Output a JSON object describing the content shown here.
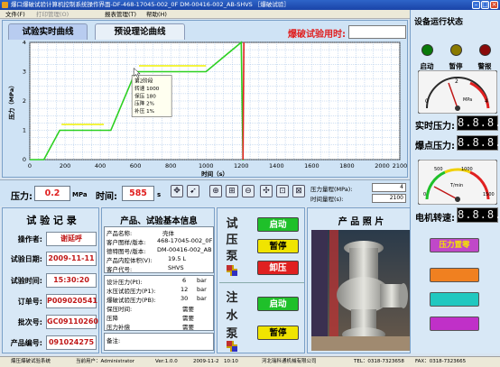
{
  "window": {
    "title": "爆口爆破试验计算机控制系统操作界面-DF-468-17045-002_0F DM-00416-002_AB-SHVS ［爆破试验］"
  },
  "menu": [
    "文件(F)",
    "打印管理(O)",
    "报表管理(T)",
    "帮助(H)"
  ],
  "chart": {
    "tabs": [
      "试验实时曲线",
      "预设理论曲线"
    ],
    "burst_time_label": "爆破试验用时:",
    "tooltip": [
      "第2阶段",
      "转速  1000",
      "保压  180",
      "压降  2%",
      "补压  1%"
    ]
  },
  "chart_data": {
    "type": "line",
    "xlabel": "时间（s）",
    "ylabel": "压力（MPa）",
    "xlim": [
      0,
      2100
    ],
    "ylim": [
      0,
      4
    ],
    "xticks": [
      0,
      200,
      400,
      600,
      800,
      1000,
      1200,
      1400,
      1600,
      1800,
      2000,
      2100
    ],
    "yticks": [
      0,
      1,
      2,
      3,
      4
    ],
    "grid": true,
    "series": [
      {
        "x": [
          0,
          80,
          170,
          190,
          270,
          420,
          460,
          600,
          660,
          980,
          1000,
          1200,
          1210,
          1215
        ],
        "y": [
          0,
          0,
          1.0,
          1.0,
          1.0,
          1.0,
          1.0,
          3.0,
          3.0,
          3.0,
          3.0,
          4.5,
          0,
          0
        ],
        "color": "#2cd020"
      },
      {
        "x": [
          1210,
          1215
        ],
        "y": [
          0,
          4.5
        ],
        "color": "#e02020"
      }
    ],
    "hold_lines": [
      {
        "x": [
          180,
          420
        ],
        "y": 1.2,
        "color": "#f0f000"
      },
      {
        "x": [
          620,
          1000
        ],
        "y": 3.2,
        "color": "#f0f000"
      }
    ],
    "tooltip_point": {
      "x": 600,
      "y": 3.0
    }
  },
  "controls": {
    "pressure_label": "压力:",
    "pressure_value": "0.2",
    "pressure_unit": "MPa",
    "time_label": "时间:",
    "time_value": "585",
    "time_unit": "s",
    "pressure_range_label": "压力量程(MPa):",
    "pressure_range_value": "4",
    "time_range_label": "时间量程(s):",
    "time_range_value": "2100"
  },
  "record": {
    "title": "试 验 记 录",
    "rows": [
      {
        "key": "操作者:",
        "value": "谢延呼"
      },
      {
        "key": "试验日期:",
        "value": "2009-11-11"
      },
      {
        "key": "试验时间:",
        "value": "15:30:20"
      },
      {
        "key": "订单号:",
        "value": "P009020541"
      },
      {
        "key": "批次号:",
        "value": "GC09110260"
      },
      {
        "key": "产品编号:",
        "value": "091024275"
      }
    ]
  },
  "info": {
    "title": "产品、试验基本信息",
    "box1": [
      {
        "k": "产品名称:",
        "v": "壳体"
      },
      {
        "k": "客户图样/版本:",
        "v": "468-17045-002_0F"
      },
      {
        "k": "德特图号/版本:",
        "v": "DM-00416-002_AB"
      },
      {
        "k": "产品内腔体积(V):",
        "v": "19.5 L"
      },
      {
        "k": "客户代号:",
        "v": "SHVS"
      }
    ],
    "box2": [
      {
        "k": "设计压力(Pt):",
        "v": "6",
        "u": "bar"
      },
      {
        "k": "水压试验压力(P1):",
        "v": "12",
        "u": "bar"
      },
      {
        "k": "爆破试验压力(PB):",
        "v": "30",
        "u": "bar"
      },
      {
        "k": "保压时间:",
        "v": "需要",
        "u": ""
      },
      {
        "k": "压降",
        "v": "需要",
        "u": ""
      },
      {
        "k": "压力补偿",
        "v": "需要",
        "u": ""
      }
    ],
    "remark_label": "备注:"
  },
  "pumps": {
    "pressure_pump_label": [
      "试",
      "压",
      "泵"
    ],
    "water_pump_label": [
      "注",
      "水",
      "泵"
    ],
    "start": "启动",
    "pause": "暂停",
    "release": "卸压"
  },
  "photo": {
    "title": "产 品 照 片"
  },
  "right": {
    "status_title": "设备运行状态",
    "leds": [
      {
        "label": "启动",
        "color": "#0a7a0a"
      },
      {
        "label": "暂停",
        "color": "#8a7a00"
      },
      {
        "label": "警报",
        "color": "#8a0a0a"
      }
    ],
    "realtime_pressure_label": "实时压力:",
    "realtime_pressure_value": "8.8.8.8",
    "burst_pressure_label": "爆点压力:",
    "burst_pressure_value": "8.8.8.8",
    "motor_speed_label": "电机转速:",
    "motor_speed_value": "8.8.8.8",
    "gauge1_unit": "MPa",
    "gauge1_ticks": [
      "0",
      "2",
      "4"
    ],
    "gauge2_unit": "T/min",
    "gauge2_ticks": [
      "0",
      "500",
      "1000",
      "1500"
    ],
    "pressure_reset": "压力置零",
    "button_colors": [
      "#c048c8",
      "#f08020",
      "#20c8c0",
      "#c030c8"
    ]
  },
  "status": {
    "system": "爆压爆破试验系统",
    "user": "当前用户：Administrator",
    "version": "Ver:1.0.0",
    "date": "2009-11-2",
    "time": "10:10",
    "company": "河北瑞科通机械有限公司",
    "tel": "TEL：0318-7323658",
    "fax": "FAX：0318-7323665"
  }
}
